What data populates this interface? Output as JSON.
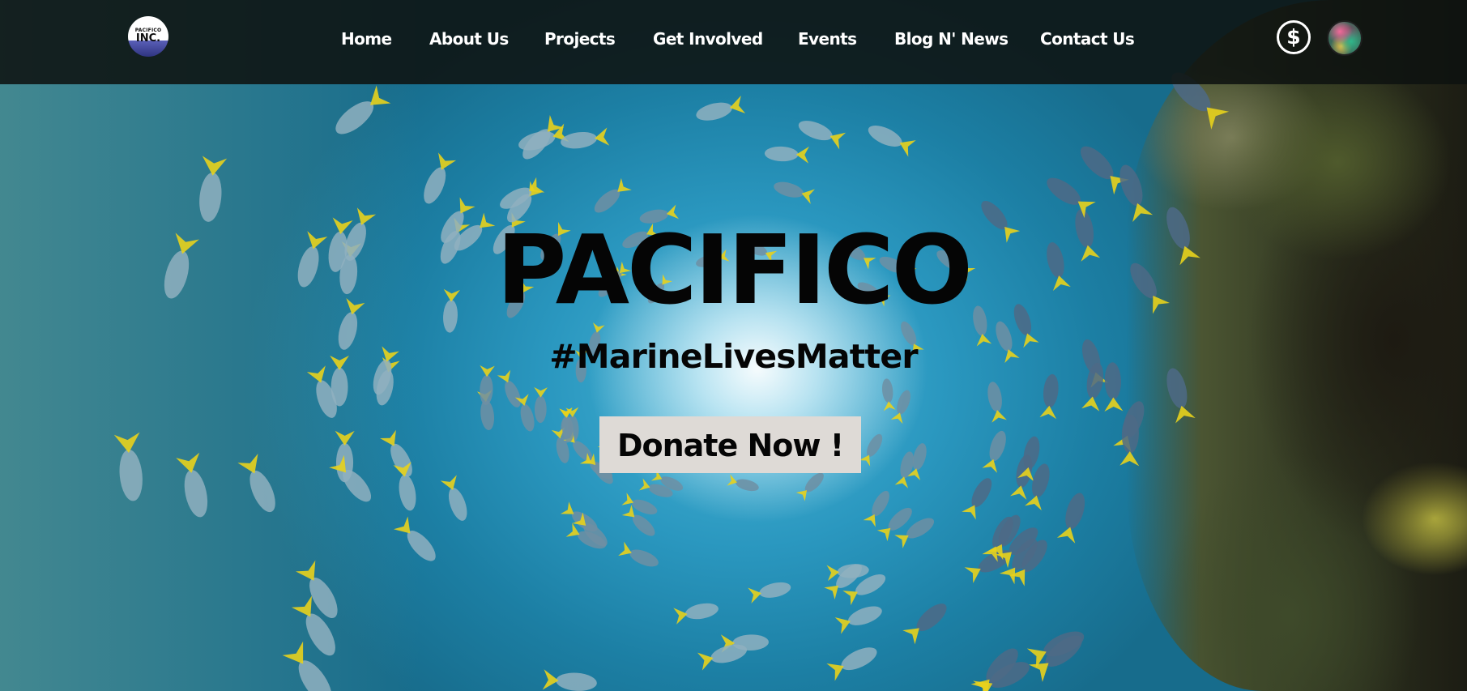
{
  "logo": {
    "top_text": "PACIFICO",
    "bottom_text": "INC."
  },
  "nav": {
    "items": [
      {
        "label": "Home"
      },
      {
        "label": "About Us"
      },
      {
        "label": "Projects"
      },
      {
        "label": "Get Involved"
      },
      {
        "label": "Events"
      },
      {
        "label": "Blog N' News"
      },
      {
        "label": "Contact Us"
      }
    ],
    "donate_icon": "dollar-circle-icon",
    "avatar_icon": "user-avatar"
  },
  "hero": {
    "title": "PACIFICO",
    "tagline": "#MarineLivesMatter",
    "button_label": "Donate Now !"
  },
  "colors": {
    "navbar": "#0e1210",
    "nav_text": "#ffffff",
    "title_text": "#050505",
    "button_bg": "#dedad6",
    "water": "#2a97bf",
    "fish_accent": "#e8d21c"
  }
}
